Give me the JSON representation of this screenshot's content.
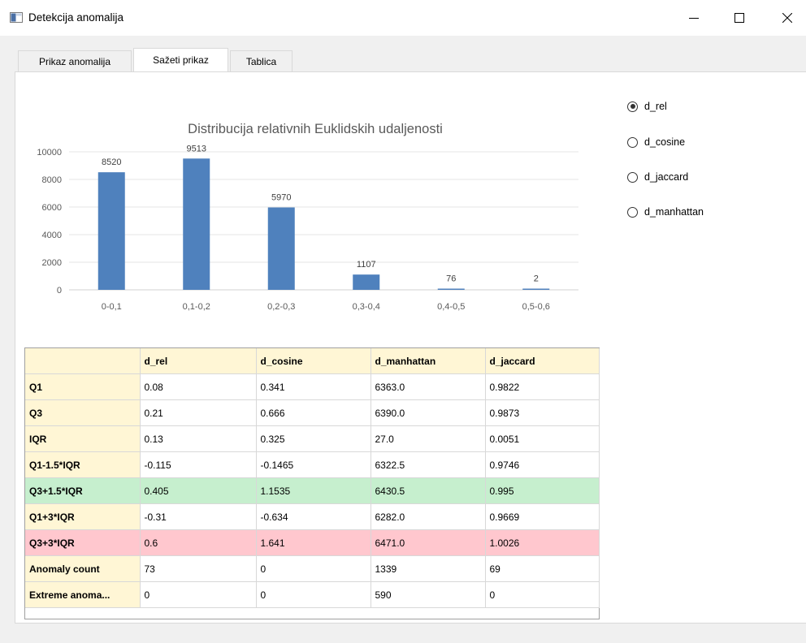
{
  "window": {
    "title": "Detekcija anomalija",
    "controls": {
      "minimize": "minimize-icon",
      "maximize": "maximize-icon",
      "close": "close-icon"
    }
  },
  "tabs": [
    {
      "label": "Prikaz anomalija",
      "active": false
    },
    {
      "label": "Sažeti prikaz",
      "active": true
    },
    {
      "label": "Tablica",
      "active": false
    }
  ],
  "metric_options": {
    "selected": "d_rel",
    "items": [
      "d_rel",
      "d_cosine",
      "d_jaccard",
      "d_manhattan"
    ]
  },
  "chart_data": {
    "type": "bar",
    "title": "Distribucija relativnih Euklidskih udaljenosti",
    "categories": [
      "0-0,1",
      "0,1-0,2",
      "0,2-0,3",
      "0,3-0,4",
      "0,4-0,5",
      "0,5-0,6"
    ],
    "values": [
      8520,
      9513,
      5970,
      1107,
      76,
      2
    ],
    "data_labels": [
      "8520",
      "9513",
      "5970",
      "1107",
      "76",
      "2"
    ],
    "ylim": [
      0,
      10000
    ],
    "yticks": [
      "0",
      "2000",
      "4000",
      "6000",
      "8000",
      "10000"
    ],
    "grid": true,
    "bar_color": "#4f81bd"
  },
  "stats_table": {
    "columns": [
      "",
      "d_rel",
      "d_cosine",
      "d_manhattan",
      "d_jaccard"
    ],
    "rows": [
      {
        "label": "Q1",
        "values": [
          "0.08",
          "0.341",
          "6363.0",
          "0.9822"
        ],
        "highlight": ""
      },
      {
        "label": "Q3",
        "values": [
          "0.21",
          "0.666",
          "6390.0",
          "0.9873"
        ],
        "highlight": ""
      },
      {
        "label": "IQR",
        "values": [
          "0.13",
          "0.325",
          "27.0",
          "0.0051"
        ],
        "highlight": ""
      },
      {
        "label": "Q1-1.5*IQR",
        "values": [
          "-0.115",
          "-0.1465",
          "6322.5",
          "0.9746"
        ],
        "highlight": ""
      },
      {
        "label": "Q3+1.5*IQR",
        "values": [
          "0.405",
          "1.1535",
          "6430.5",
          "0.995"
        ],
        "highlight": "green"
      },
      {
        "label": "Q1+3*IQR",
        "values": [
          "-0.31",
          "-0.634",
          "6282.0",
          "0.9669"
        ],
        "highlight": ""
      },
      {
        "label": "Q3+3*IQR",
        "values": [
          "0.6",
          "1.641",
          "6471.0",
          "1.0026"
        ],
        "highlight": "red"
      },
      {
        "label": "Anomaly count",
        "values": [
          "73",
          "0",
          "1339",
          "69"
        ],
        "highlight": ""
      },
      {
        "label": "Extreme anoma...",
        "values": [
          "0",
          "0",
          "590",
          "0"
        ],
        "highlight": ""
      }
    ],
    "colors": {
      "header_bg": "#fff6d5",
      "green": "#c6efce",
      "red": "#ffc7ce"
    }
  }
}
